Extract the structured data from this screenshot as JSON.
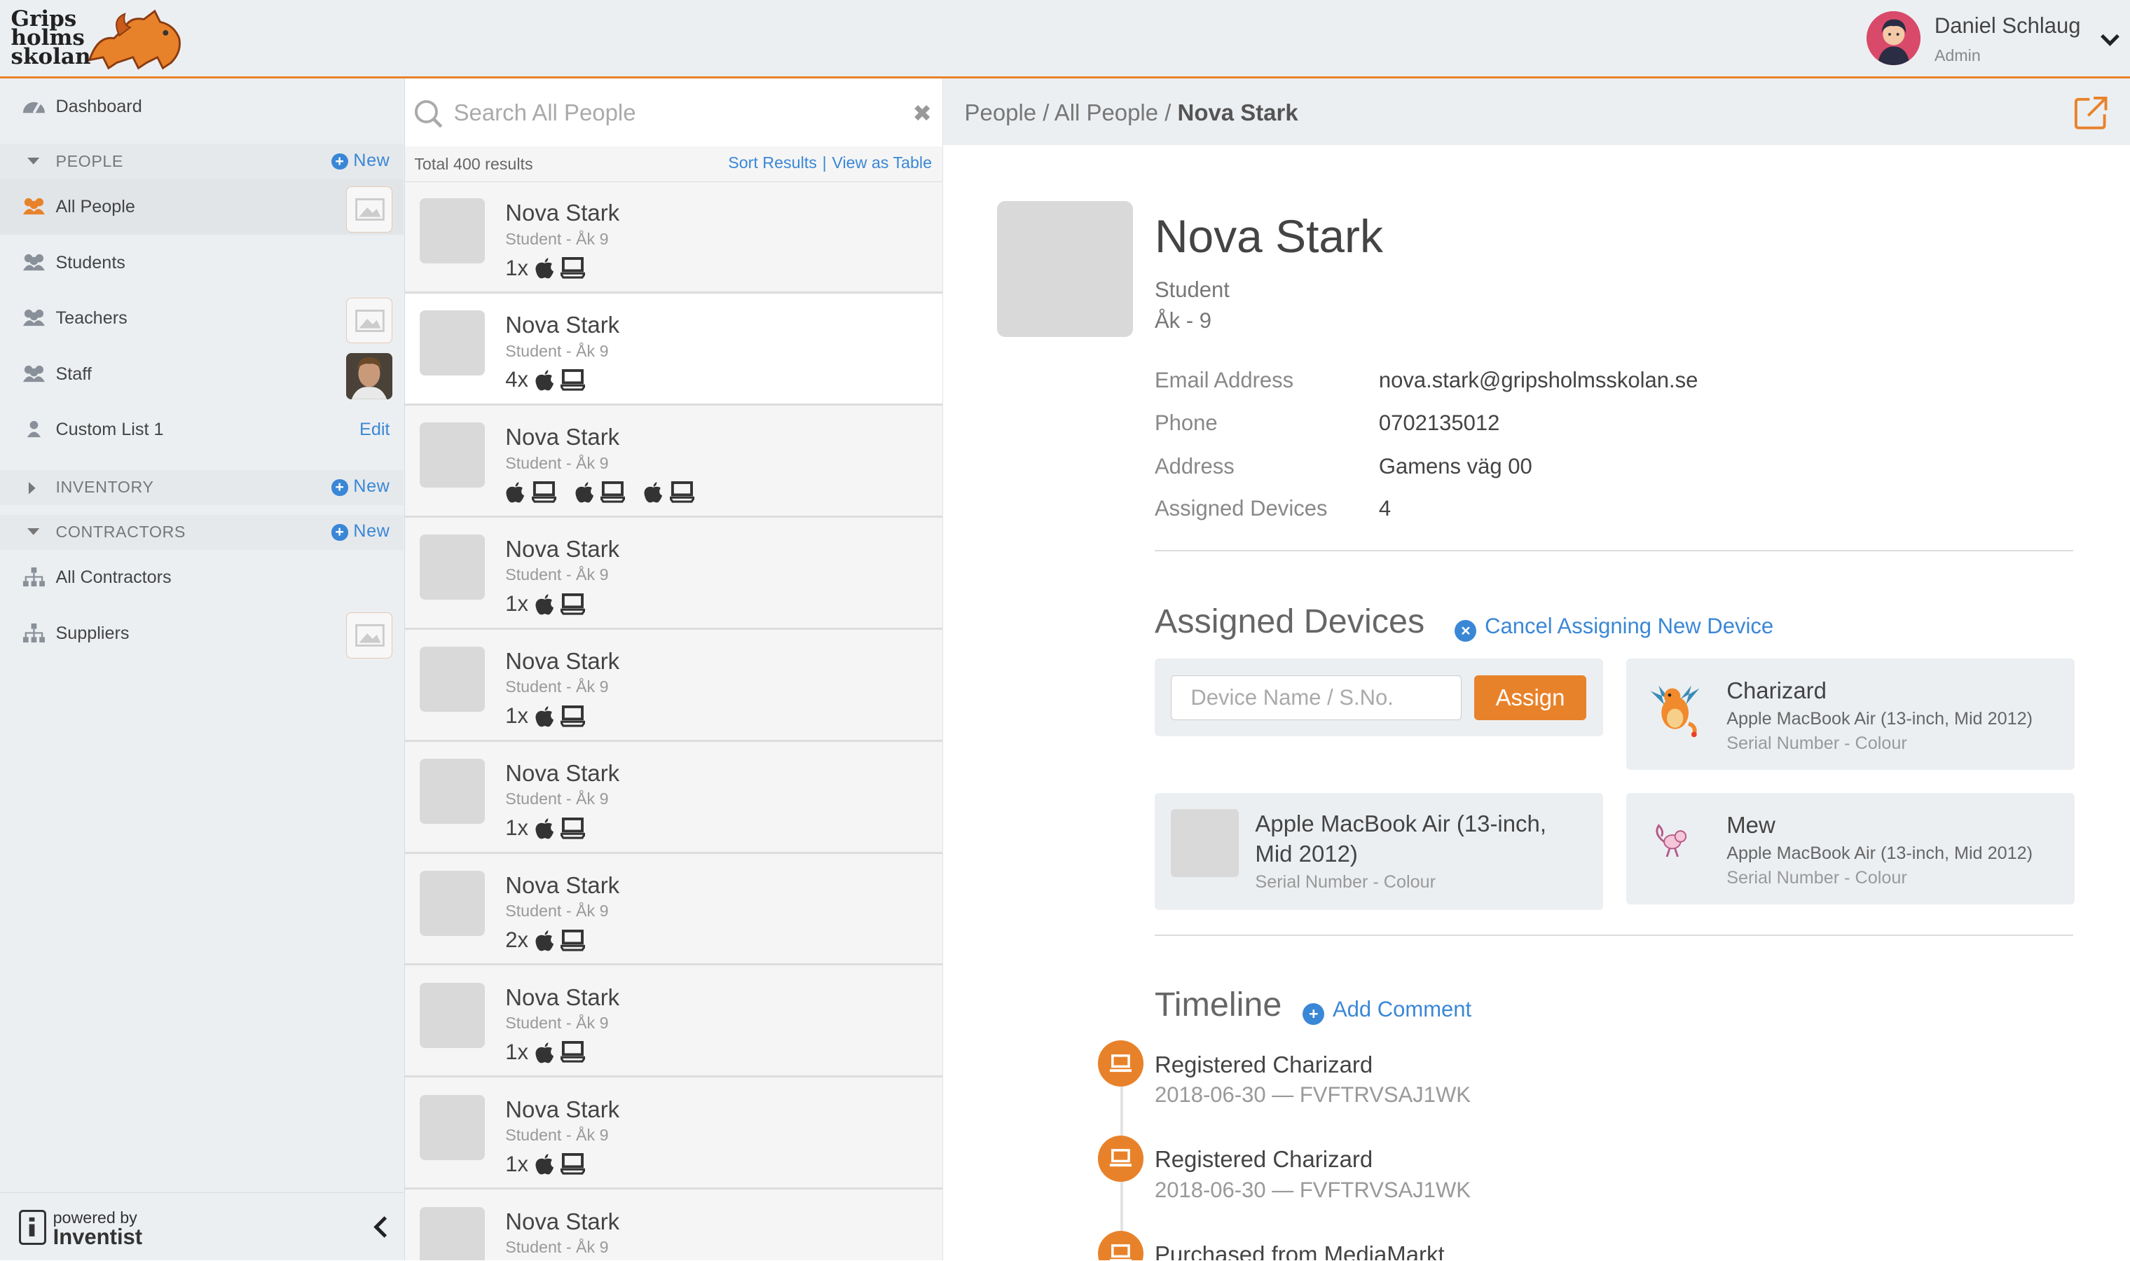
{
  "brand": {
    "logo_lines": [
      "Grips",
      "holms",
      "skolan"
    ]
  },
  "user": {
    "name": "Daniel Schlaug",
    "role": "Admin"
  },
  "sidebar": {
    "dashboard": "Dashboard",
    "people_section": "PEOPLE",
    "new_label": "New",
    "items": [
      {
        "label": "All People"
      },
      {
        "label": "Students"
      },
      {
        "label": "Teachers"
      },
      {
        "label": "Staff"
      },
      {
        "label": "Custom List 1"
      }
    ],
    "edit_label": "Edit",
    "inventory_section": "INVENTORY",
    "contractors_section": "CONTRACTORS",
    "contractor_items": [
      {
        "label": "All Contractors"
      },
      {
        "label": "Suppliers"
      }
    ],
    "powered_by": "powered by",
    "powered_brand": "Inventist"
  },
  "search": {
    "placeholder": "Search All People",
    "clear": "✖"
  },
  "results": {
    "total": "Total 400 results",
    "sort": "Sort Results",
    "separator": "|",
    "view_table": "View as Table",
    "rows": [
      {
        "name": "Nova Stark",
        "sub": "Student - Åk 9",
        "count": "1x"
      },
      {
        "name": "Nova Stark",
        "sub": "Student - Åk 9",
        "count": "4x"
      },
      {
        "name": "Nova Stark",
        "sub": "Student - Åk 9",
        "count": ""
      },
      {
        "name": "Nova Stark",
        "sub": "Student - Åk 9",
        "count": "1x"
      },
      {
        "name": "Nova Stark",
        "sub": "Student - Åk 9",
        "count": "1x"
      },
      {
        "name": "Nova Stark",
        "sub": "Student - Åk 9",
        "count": "1x"
      },
      {
        "name": "Nova Stark",
        "sub": "Student - Åk 9",
        "count": "2x"
      },
      {
        "name": "Nova Stark",
        "sub": "Student - Åk 9",
        "count": "1x"
      },
      {
        "name": "Nova Stark",
        "sub": "Student - Åk 9",
        "count": "1x"
      },
      {
        "name": "Nova Stark",
        "sub": "Student - Åk 9",
        "count": ""
      }
    ]
  },
  "breadcrumb": {
    "people": "People",
    "sep": "/",
    "all_people": "All People",
    "current": "Nova Stark"
  },
  "person": {
    "name": "Nova Stark",
    "role": "Student",
    "grade": "Åk - 9",
    "fields": [
      {
        "label": "Email Address",
        "value": "nova.stark@gripsholmsskolan.se"
      },
      {
        "label": "Phone",
        "value": "0702135012"
      },
      {
        "label": "Address",
        "value": "Gamens väg 00"
      },
      {
        "label": "Assigned Devices",
        "value": "4"
      }
    ]
  },
  "devices": {
    "title": "Assigned Devices",
    "cancel_link": "Cancel Assigning New Device",
    "input_placeholder": "Device Name / S.No.",
    "assign_button": "Assign",
    "cards": [
      {
        "name": "Charizard",
        "model": "Apple MacBook Air (13-inch, Mid 2012)",
        "serial": "Serial Number - Colour",
        "icon": "charizard-icon"
      },
      {
        "name": "Apple MacBook Air (13-inch, Mid 2012)",
        "serial": "Serial Number - Colour",
        "icon": "device-placeholder"
      },
      {
        "name": "Mew",
        "model": "Apple MacBook Air (13-inch, Mid 2012)",
        "serial": "Serial Number - Colour",
        "icon": "mew-icon"
      }
    ]
  },
  "timeline": {
    "title": "Timeline",
    "add_comment": "Add Comment",
    "events": [
      {
        "title": "Registered Charizard",
        "sub": "2018-06-30 — FVFTRVSAJ1WK"
      },
      {
        "title": "Registered Charizard",
        "sub": "2018-06-30 — FVFTRVSAJ1WK"
      },
      {
        "title": "Purchased from MediaMarkt",
        "sub": ""
      }
    ]
  },
  "colors": {
    "accent": "#e8822a",
    "link": "#3a87d6",
    "sidebar_bg": "#eceff2"
  }
}
